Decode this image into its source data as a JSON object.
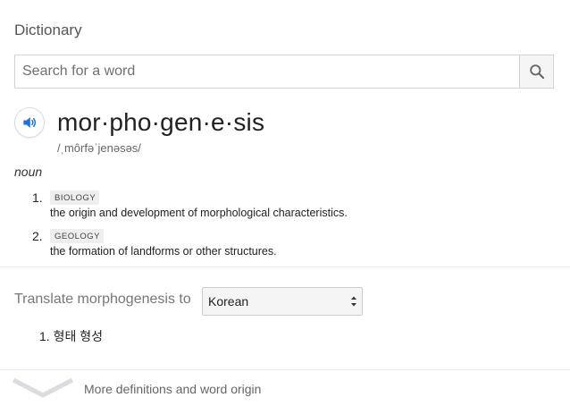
{
  "card": {
    "heading": "Dictionary"
  },
  "search": {
    "placeholder": "Search for a word",
    "icon": "search-icon"
  },
  "entry": {
    "speaker_icon": "speaker-icon",
    "headword": "mor·pho·gen·e·sis",
    "phonetic": "/ˌmôrfəˈjenəsəs/",
    "part_of_speech": "noun",
    "definitions": [
      {
        "number": "1.",
        "domain": "BIOLOGY",
        "text": "the origin and development of morphological characteristics."
      },
      {
        "number": "2.",
        "domain": "GEOLOGY",
        "text": "the formation of landforms or other structures."
      }
    ]
  },
  "translate": {
    "label": "Translate morphogenesis to",
    "selected_language": "Korean",
    "results": [
      {
        "number": "1.",
        "text": "형태 형성"
      }
    ]
  },
  "more": {
    "label": "More definitions and word origin",
    "icon": "chevron-down-icon"
  },
  "colors": {
    "accent_blue": "#1a73e8",
    "divider": "#ebebeb",
    "tag_bg": "#eeeeee"
  }
}
